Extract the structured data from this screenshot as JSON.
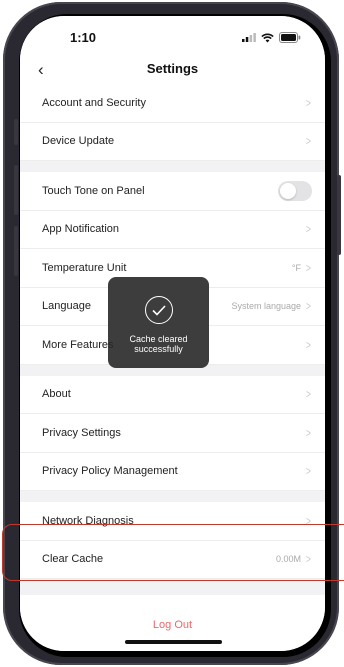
{
  "status_bar": {
    "time": "1:10"
  },
  "header": {
    "title": "Settings"
  },
  "groups": [
    [
      {
        "label": "Account and Security",
        "value": "",
        "control": "chevron"
      },
      {
        "label": "Device Update",
        "value": "",
        "control": "chevron"
      }
    ],
    [
      {
        "label": "Touch Tone on Panel",
        "value": "",
        "control": "toggle",
        "state": "off"
      },
      {
        "label": "App Notification",
        "value": "",
        "control": "chevron"
      },
      {
        "label": "Temperature Unit",
        "value": "°F",
        "control": "chevron"
      },
      {
        "label": "Language",
        "value": "System language",
        "control": "chevron"
      },
      {
        "label": "More Features",
        "value": "",
        "control": "chevron"
      }
    ],
    [
      {
        "label": "About",
        "value": "",
        "control": "chevron"
      },
      {
        "label": "Privacy Settings",
        "value": "",
        "control": "chevron"
      },
      {
        "label": "Privacy Policy Management",
        "value": "",
        "control": "chevron"
      }
    ],
    [
      {
        "label": "Network Diagnosis",
        "value": "",
        "control": "chevron"
      },
      {
        "label": "Clear Cache",
        "value": "0.00M",
        "control": "chevron"
      }
    ]
  ],
  "logout_label": "Log Out",
  "toast": {
    "message": "Cache cleared successfully"
  },
  "colors": {
    "logout": "#e8696b",
    "highlight": "#c0392b",
    "toast_bg": "#282828"
  }
}
